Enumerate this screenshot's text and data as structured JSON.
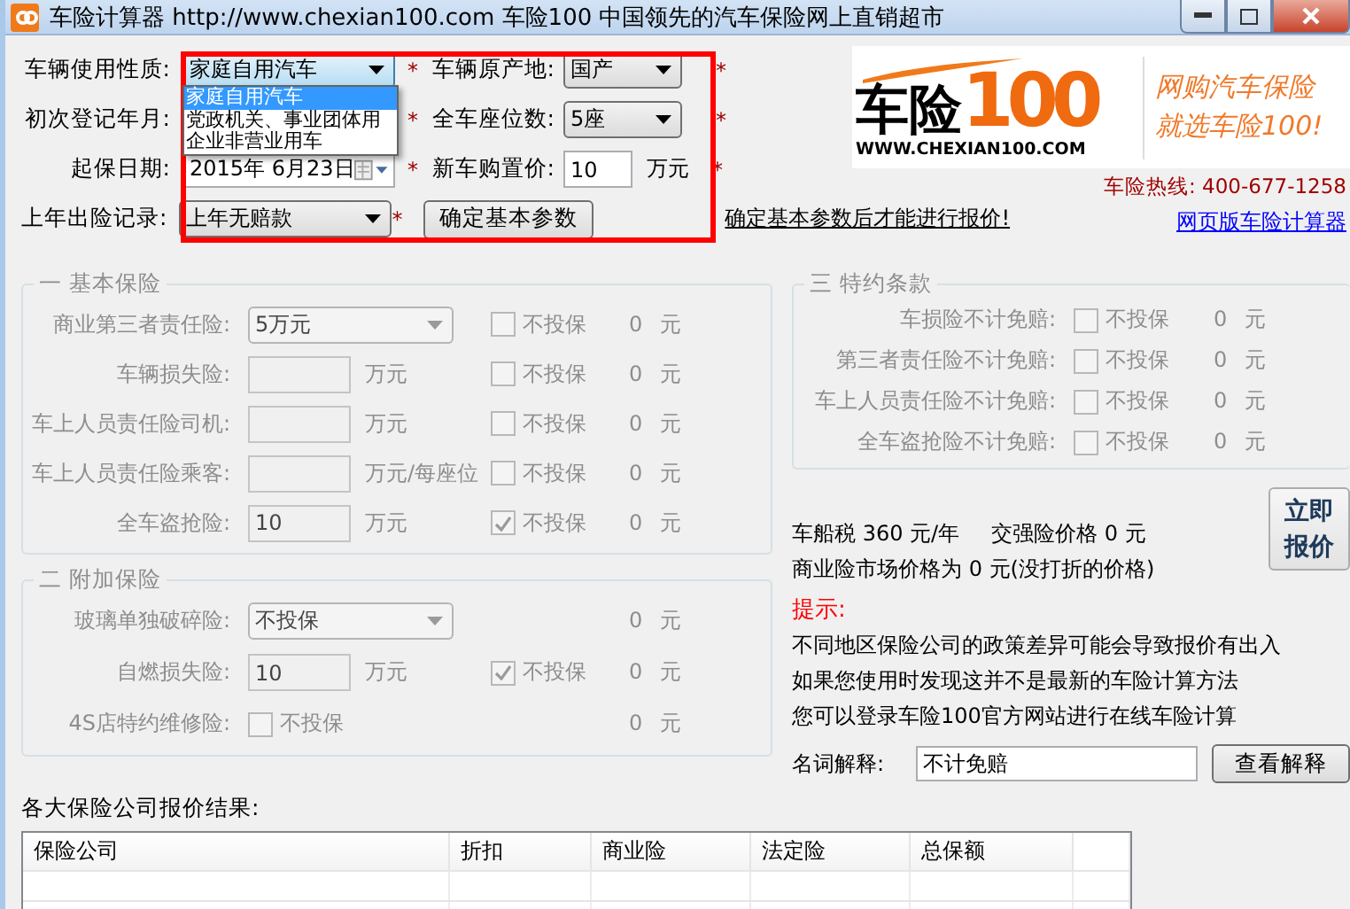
{
  "window": {
    "title": "车险计算器 http://www.chexian100.com 车险100 中国领先的汽车保险网上直销超市"
  },
  "basic_params": {
    "rows": [
      {
        "label": "车辆使用性质:",
        "field": {
          "kind": "select",
          "value": "家庭自用汽车",
          "expanded": true
        },
        "required": "*",
        "right": {
          "label": "车辆原产地:",
          "field": {
            "kind": "select",
            "value": "国产"
          },
          "required": "*"
        }
      },
      {
        "label": "初次登记年月:",
        "required": "*",
        "right": {
          "label": "全车座位数:",
          "field": {
            "kind": "select",
            "value": "5座"
          },
          "required": "*"
        }
      },
      {
        "label": "起保日期:",
        "field": {
          "kind": "date",
          "value": "2015年  6月23日"
        },
        "required": "*",
        "right": {
          "label": "新车购置价:",
          "field": {
            "kind": "input",
            "value": "10"
          },
          "unit": "万元",
          "required": "*"
        }
      },
      {
        "label": "上年出险记录:",
        "field": {
          "kind": "select",
          "value": "上年无赔款"
        },
        "required": "*",
        "button": "确定基本参数",
        "notice": "确定基本参数后才能进行报价!"
      }
    ],
    "dropdown_options": [
      {
        "label": "家庭自用汽车",
        "selected": true
      },
      {
        "label": "党政机关、事业团体用",
        "selected": false
      },
      {
        "label": "企业非营业用车",
        "selected": false
      }
    ]
  },
  "banner": {
    "brand": "车险",
    "number": "100",
    "url": "WWW.CHEXIAN100.COM",
    "slogan": [
      "网购汽车保险",
      "就选车险100!"
    ]
  },
  "hotline": "车险热线: 400-677-1258",
  "web_link": "网页版车险计算器",
  "basic_insurance": {
    "title": "一 基本保险",
    "disabled": true,
    "rows": [
      {
        "label": "商业第三者责任险:",
        "kind": "select",
        "value": "5万元",
        "option": {
          "label": "不投保",
          "checked": false
        },
        "amount": "0 元"
      },
      {
        "label": "车辆损失险:",
        "kind": "input",
        "unit": "万元",
        "option": {
          "label": "不投保",
          "checked": false
        },
        "amount": "0 元"
      },
      {
        "label": "车上人员责任险司机:",
        "kind": "input",
        "unit": "万元",
        "option": {
          "label": "不投保",
          "checked": false
        },
        "amount": "0 元"
      },
      {
        "label": "车上人员责任险乘客:",
        "kind": "input",
        "unit": "万元/每座位",
        "option": {
          "label": "不投保",
          "checked": false
        },
        "amount": "0 元"
      },
      {
        "label": "全车盗抢险:",
        "kind": "input",
        "value": "10",
        "unit": "万元",
        "option": {
          "label": "不投保",
          "checked": true
        },
        "amount": "0 元"
      }
    ]
  },
  "additional_insurance": {
    "title": "二 附加保险",
    "disabled": true,
    "rows": [
      {
        "label": "玻璃单独破碎险:",
        "kind": "select",
        "value": "不投保",
        "amount": "0 元"
      },
      {
        "label": "自燃损失险:",
        "kind": "input",
        "value": "10",
        "unit": "万元",
        "option": {
          "label": "不投保",
          "checked": true
        },
        "amount": "0 元"
      },
      {
        "label": "4S店特约维修险:",
        "kind": "checkbox",
        "option": {
          "label": "不投保",
          "checked": false
        },
        "amount": "0 元"
      }
    ]
  },
  "special_terms": {
    "title": "三 特约条款",
    "disabled": true,
    "rows": [
      {
        "label": "车损险不计免赔:",
        "option": {
          "label": "不投保",
          "checked": false
        },
        "amount": "0 元"
      },
      {
        "label": "第三者责任险不计免赔:",
        "option": {
          "label": "不投保",
          "checked": false
        },
        "amount": "0 元"
      },
      {
        "label": "车上人员责任险不计免赔:",
        "option": {
          "label": "不投保",
          "checked": false
        },
        "amount": "0 元"
      },
      {
        "label": "全车盗抢险不计免赔:",
        "option": {
          "label": "不投保",
          "checked": false
        },
        "amount": "0 元"
      }
    ]
  },
  "summary": {
    "tax": "车船税 360 元/年",
    "compulsory": "交强险价格 0 元",
    "market_price": "商业险市场价格为 0 元(没打折的价格)",
    "quote_button": "立即报价"
  },
  "tips": {
    "title": "提示:",
    "lines": [
      "不同地区保险公司的政策差异可能会导致报价有出入",
      "如果您使用时发现这并不是最新的车险计算方法",
      "您可以登录车险100官方网站进行在线车险计算"
    ]
  },
  "glossary": {
    "label": "名词解释:",
    "value": "不计免赔",
    "button": "查看解释"
  },
  "results": {
    "title": "各大保险公司报价结果:",
    "columns": [
      "保险公司",
      "折扣",
      "商业险",
      "法定险",
      "总保额"
    ]
  }
}
